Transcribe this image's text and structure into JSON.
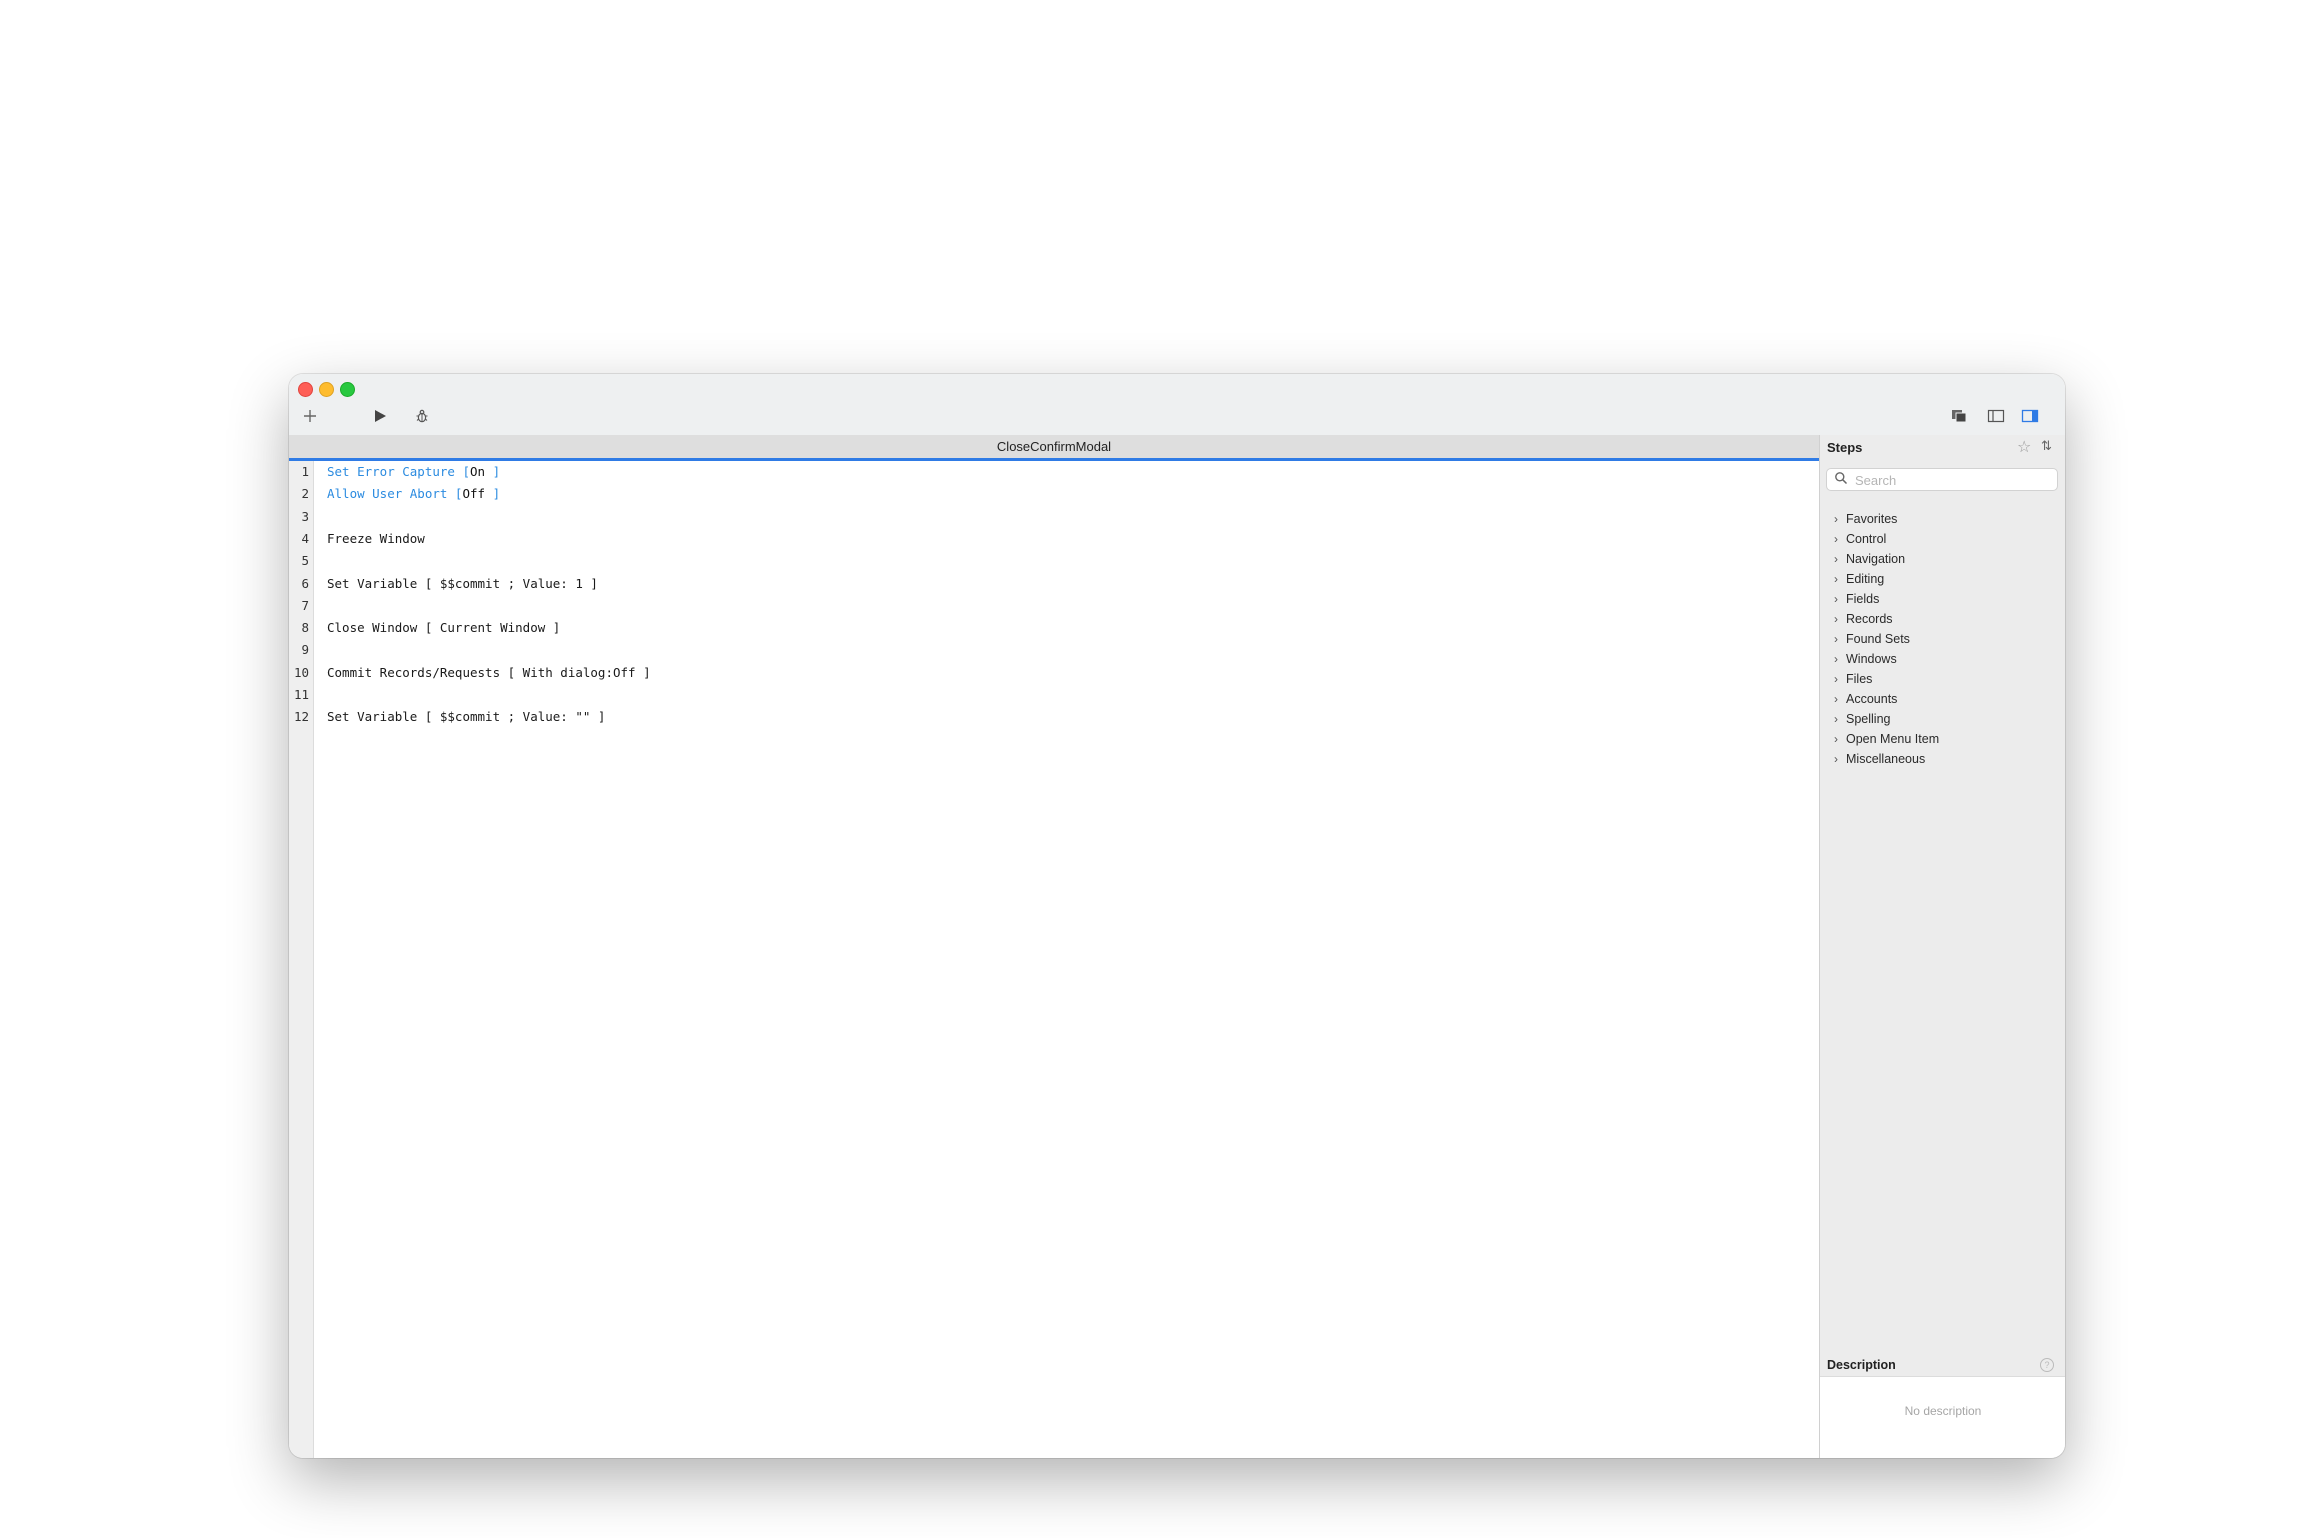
{
  "window": {
    "title": "CloseConfirmModal"
  },
  "toolbar": {
    "add_icon": "plus-icon",
    "run_icon": "play-icon",
    "debug_icon": "bug-icon",
    "right_icons": [
      "windows-icon",
      "left-panel-icon",
      "right-panel-icon"
    ]
  },
  "script": {
    "lines": [
      {
        "num": "1",
        "text": "Set Error Capture [",
        "value": "On",
        "close": " ]",
        "style": "blue"
      },
      {
        "num": "2",
        "text": "Allow User Abort [",
        "value": "Off",
        "close": " ]",
        "style": "blue"
      },
      {
        "num": "3",
        "text": ""
      },
      {
        "num": "4",
        "text": "Freeze Window"
      },
      {
        "num": "5",
        "text": ""
      },
      {
        "num": "6",
        "text": "Set Variable [ $$commit ; Value: 1 ]"
      },
      {
        "num": "7",
        "text": ""
      },
      {
        "num": "8",
        "text": "Close Window [ Current Window ]"
      },
      {
        "num": "9",
        "text": ""
      },
      {
        "num": "10",
        "text": "Commit Records/Requests [ With dialog:Off ]"
      },
      {
        "num": "11",
        "text": ""
      },
      {
        "num": "12",
        "text": "Set Variable [ $$commit ; Value: \"\" ]"
      }
    ]
  },
  "steps": {
    "title": "Steps",
    "search_placeholder": "Search",
    "categories": [
      "Favorites",
      "Control",
      "Navigation",
      "Editing",
      "Fields",
      "Records",
      "Found Sets",
      "Windows",
      "Files",
      "Accounts",
      "Spelling",
      "Open Menu Item",
      "Miscellaneous"
    ]
  },
  "description": {
    "title": "Description",
    "help": "?",
    "empty_text": "No description"
  },
  "colors": {
    "accent": "#2f7be5",
    "keyword_blue": "#2b8be0",
    "sidebar_bg": "#ececec"
  }
}
